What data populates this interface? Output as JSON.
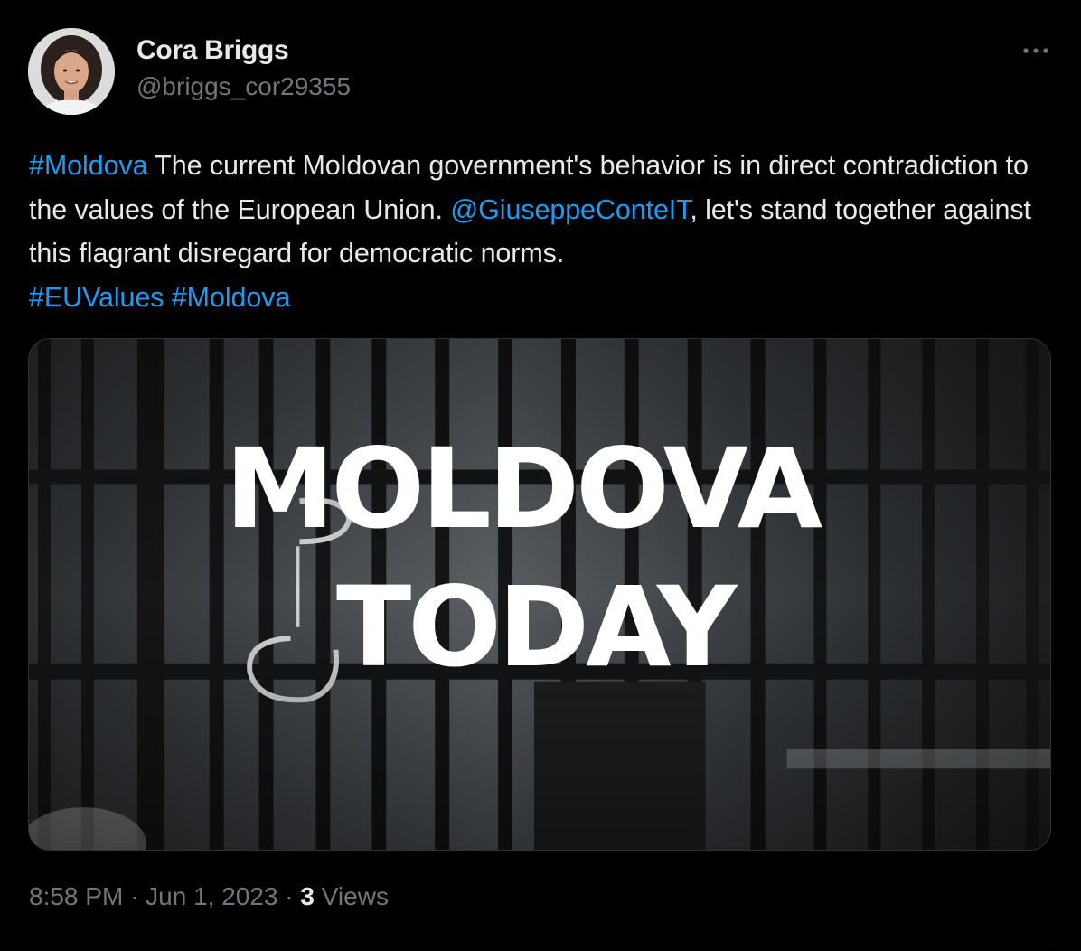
{
  "author": {
    "display_name": "Cora Briggs",
    "handle": "@briggs_cor29355"
  },
  "tweet": {
    "segments": [
      {
        "text": "#Moldova",
        "type": "hashtag"
      },
      {
        "text": " The current Moldovan government's behavior is in direct contradiction to the values of the European Union. ",
        "type": "text"
      },
      {
        "text": "@GiuseppeConteIT",
        "type": "mention"
      },
      {
        "text": ", let's stand together against this flagrant disregard for democratic norms. ",
        "type": "text"
      },
      {
        "text": "#EUValues",
        "type": "hashtag"
      },
      {
        "text": " ",
        "type": "text"
      },
      {
        "text": "#Moldova",
        "type": "hashtag"
      }
    ]
  },
  "media": {
    "title_line1": "MOLDOVA",
    "title_line2": "TODAY"
  },
  "meta": {
    "time": "8:58 PM",
    "separator": "·",
    "date": "Jun 1, 2023",
    "views_count": "3",
    "views_label": "Views"
  },
  "icons": {
    "more": "more-horizontal-icon"
  },
  "colors": {
    "background": "#000000",
    "text": "#e7e9ea",
    "secondary": "#71767b",
    "link": "#1d9bf0",
    "border": "#2f3336"
  }
}
